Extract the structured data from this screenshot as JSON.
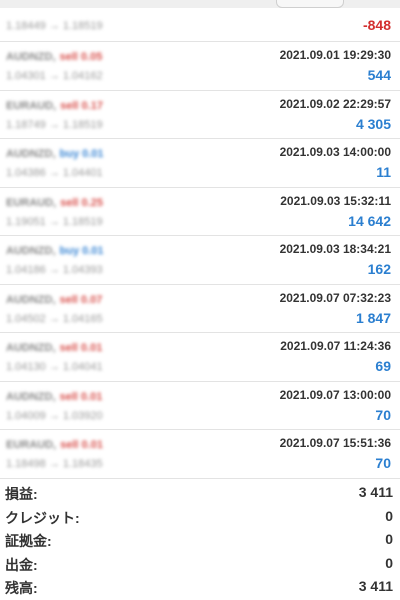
{
  "trades": [
    {
      "symbol": "",
      "side": "",
      "side_type": "",
      "prices": "1.18449 → 1.18519",
      "datetime": "",
      "profit": "-848",
      "profit_sign": "neg"
    },
    {
      "symbol": "AUDNZD,",
      "side": "sell 0.05",
      "side_type": "sell",
      "prices": "1.04301 → 1.04162",
      "datetime": "2021.09.01 19:29:30",
      "profit": "544",
      "profit_sign": "pos"
    },
    {
      "symbol": "EURAUD,",
      "side": "sell 0.17",
      "side_type": "sell",
      "prices": "1.18749 → 1.18519",
      "datetime": "2021.09.02 22:29:57",
      "profit": "4 305",
      "profit_sign": "pos"
    },
    {
      "symbol": "AUDNZD,",
      "side": "buy 0.01",
      "side_type": "buy",
      "prices": "1.04386 → 1.04401",
      "datetime": "2021.09.03 14:00:00",
      "profit": "11",
      "profit_sign": "pos"
    },
    {
      "symbol": "EURAUD,",
      "side": "sell 0.25",
      "side_type": "sell",
      "prices": "1.19051 → 1.18519",
      "datetime": "2021.09.03 15:32:11",
      "profit": "14 642",
      "profit_sign": "pos"
    },
    {
      "symbol": "AUDNZD,",
      "side": "buy 0.01",
      "side_type": "buy",
      "prices": "1.04186 → 1.04393",
      "datetime": "2021.09.03 18:34:21",
      "profit": "162",
      "profit_sign": "pos"
    },
    {
      "symbol": "AUDNZD,",
      "side": "sell 0.07",
      "side_type": "sell",
      "prices": "1.04502 → 1.04165",
      "datetime": "2021.09.07 07:32:23",
      "profit": "1 847",
      "profit_sign": "pos"
    },
    {
      "symbol": "AUDNZD,",
      "side": "sell 0.01",
      "side_type": "sell",
      "prices": "1.04130 → 1.04041",
      "datetime": "2021.09.07 11:24:36",
      "profit": "69",
      "profit_sign": "pos"
    },
    {
      "symbol": "AUDNZD,",
      "side": "sell 0.01",
      "side_type": "sell",
      "prices": "1.04009 → 1.03920",
      "datetime": "2021.09.07 13:00:00",
      "profit": "70",
      "profit_sign": "pos"
    },
    {
      "symbol": "EURAUD,",
      "side": "sell 0.01",
      "side_type": "sell",
      "prices": "1.18498 → 1.18435",
      "datetime": "2021.09.07 15:51:36",
      "profit": "70",
      "profit_sign": "pos"
    }
  ],
  "summary": [
    {
      "label": "損益:",
      "value": "3 411"
    },
    {
      "label": "クレジット:",
      "value": "0"
    },
    {
      "label": "証拠金:",
      "value": "0"
    },
    {
      "label": "出金:",
      "value": "0"
    },
    {
      "label": "残高:",
      "value": "3 411"
    }
  ],
  "colors": {
    "profit_positive": "#2b7fd0",
    "profit_negative": "#d32f2f",
    "sell": "#d9534f",
    "buy": "#3a86d4"
  }
}
